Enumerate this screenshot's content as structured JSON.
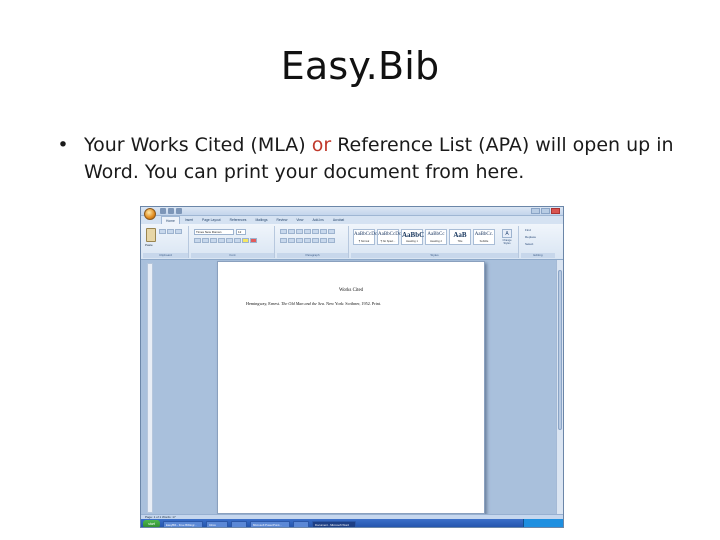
{
  "slide": {
    "title": "Easy.Bib",
    "bullet_symbol": "•",
    "bullet_part1": "Your Works Cited (MLA) ",
    "bullet_highlight": "or",
    "bullet_part2": " Reference List (APA) will open up in Word.  You can print your document from here.",
    "highlight_color": "#c0392b"
  },
  "word": {
    "tabs": [
      "Home",
      "Insert",
      "Page Layout",
      "References",
      "Mailings",
      "Review",
      "View",
      "Add-Ins",
      "Acrobat"
    ],
    "groups": {
      "clipboard": "Clipboard",
      "font": "Font",
      "paragraph": "Paragraph",
      "styles": "Styles",
      "editing": "Editing"
    },
    "paste_label": "Paste",
    "font_name": "Times New Roman",
    "font_size": "12",
    "styles": [
      {
        "sample": "AaBbCcDc",
        "name": "¶ Normal"
      },
      {
        "sample": "AaBbCcDc",
        "name": "¶ No Spaci..."
      },
      {
        "sample": "AaBbC",
        "name": "Heading 1"
      },
      {
        "sample": "AaBbCc",
        "name": "Heading 2"
      },
      {
        "sample": "AaB",
        "name": "Title"
      },
      {
        "sample": "AaBbCc.",
        "name": "Subtitle"
      }
    ],
    "change_styles": "Change Styles",
    "editing_items": [
      "Find",
      "Replace",
      "Select"
    ],
    "document": {
      "heading": "Works Cited",
      "entry_author": "Hemingway, Ernest. ",
      "entry_title": "The Old Man and the Sea",
      "entry_rest": ". New York: Scribner, 1952. Print."
    },
    "status": "Page: 1 of 1   Words: 17",
    "taskbar": {
      "start": "start",
      "items": [
        "EasyBib - Free Bibliogr...",
        "Inbox",
        "",
        "Microsoft PowerPoint...",
        "",
        "Document - Microsoft Word"
      ]
    }
  }
}
